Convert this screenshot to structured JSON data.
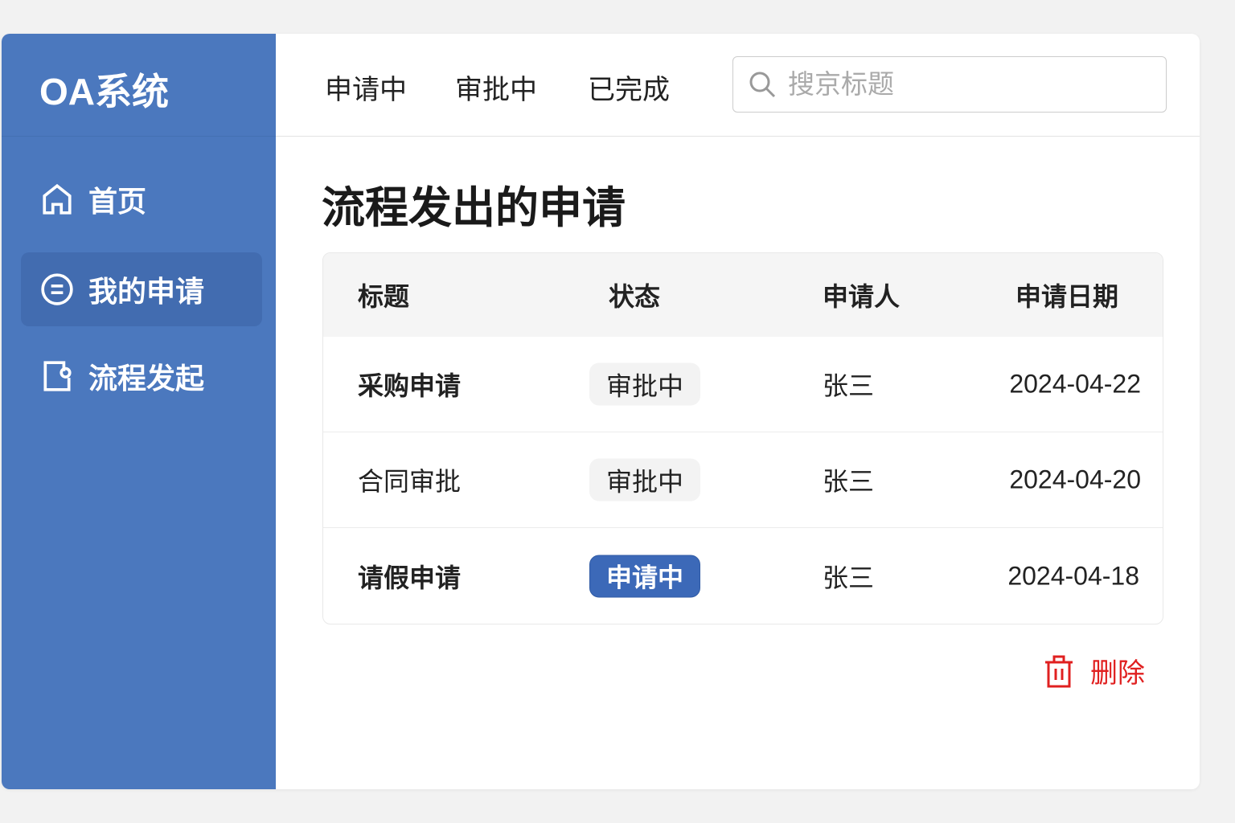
{
  "app": {
    "title": "OA系统"
  },
  "sidebar": {
    "items": [
      {
        "label": "首页",
        "icon": "home-icon"
      },
      {
        "label": "我的申请",
        "icon": "list-circle-icon",
        "active": true
      },
      {
        "label": "流程发起",
        "icon": "document-edit-icon"
      }
    ]
  },
  "topbar": {
    "tabs": [
      "申请中",
      "审批中",
      "已完成"
    ],
    "search_placeholder": "搜京标题",
    "search_value": ""
  },
  "page": {
    "title": "流程发出的申请"
  },
  "table": {
    "headers": [
      "标题",
      "状态",
      "申请人",
      "申请日期"
    ],
    "rows": [
      {
        "title": "采购申请",
        "status": "审批中",
        "applicant": "张三",
        "date": "2024-04-22"
      },
      {
        "title": "合同审批",
        "status": "审批中",
        "applicant": "张三",
        "date": "2024-04-20"
      },
      {
        "title": "请假申请",
        "status": "申请中",
        "applicant": "张三",
        "date": "2024-04-18"
      }
    ]
  },
  "actions": {
    "delete_label": "删除"
  },
  "colors": {
    "sidebar": "#4b78be",
    "badge_active": "#3c69b8",
    "danger": "#e02020"
  }
}
